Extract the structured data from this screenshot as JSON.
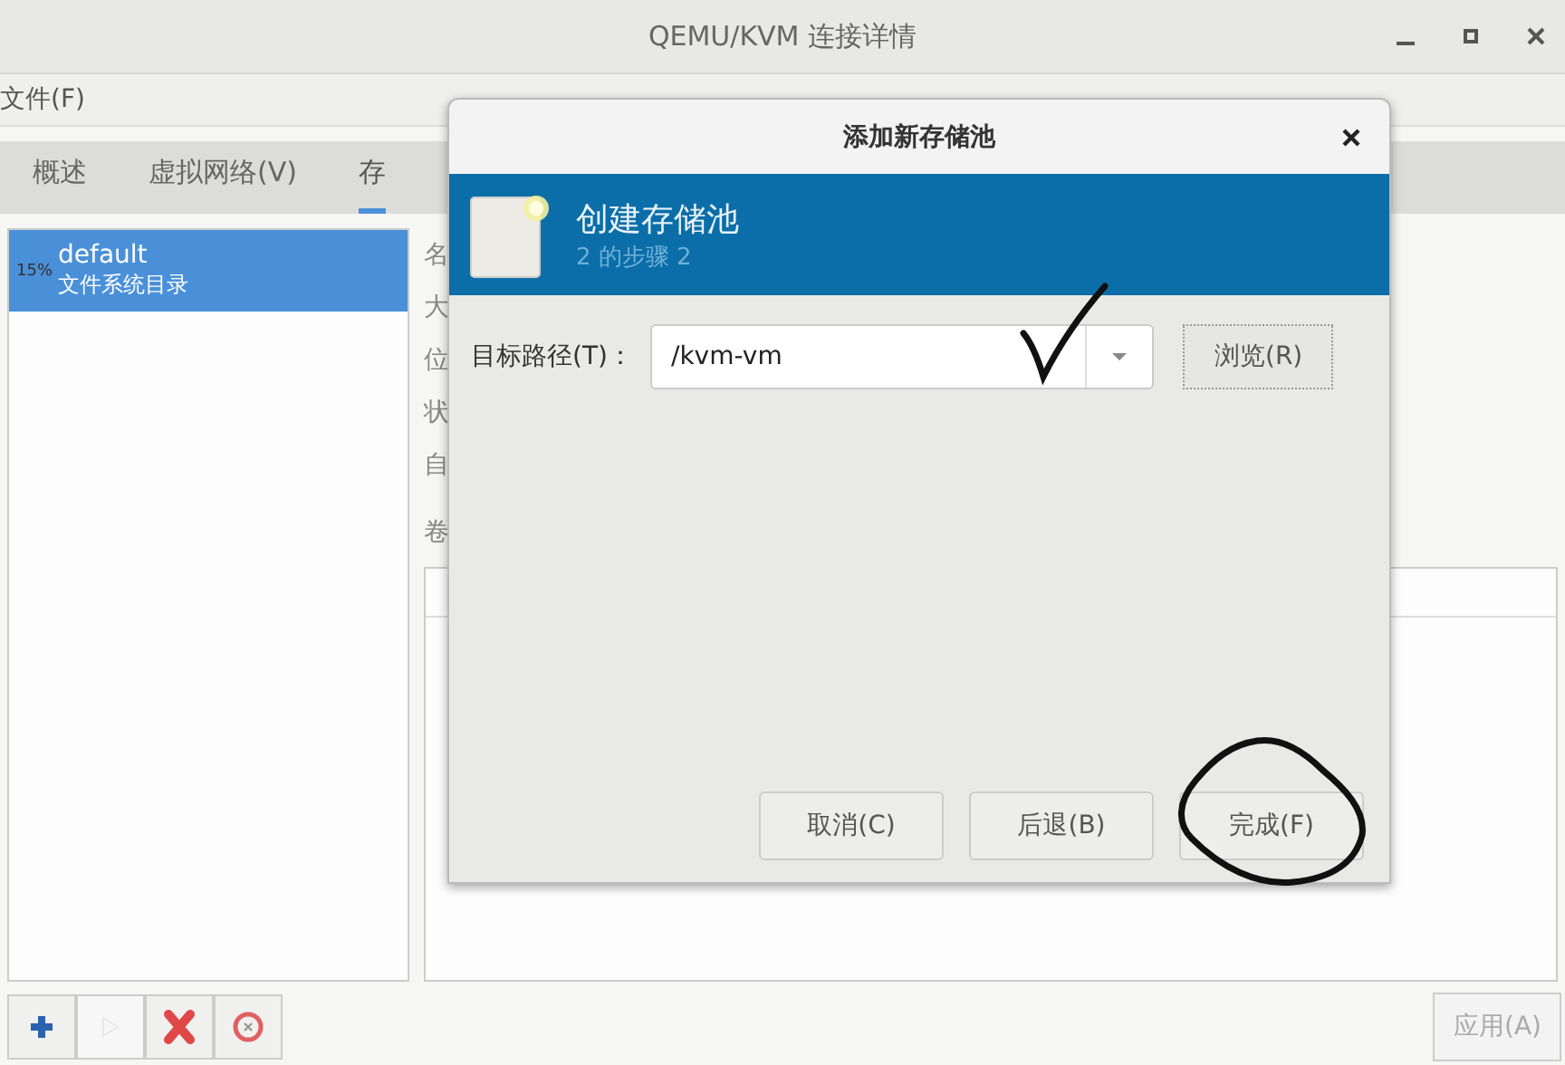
{
  "window": {
    "title": "QEMU/KVM 连接详情"
  },
  "menu": [
    "文件(F)"
  ],
  "tabs": [
    {
      "label": "概述",
      "selected": false
    },
    {
      "label": "虚拟网络(V)",
      "selected": false
    },
    {
      "label": "存",
      "selected": true
    }
  ],
  "pools": [
    {
      "usage": "15%",
      "name": "default",
      "type": "文件系统目录",
      "selected": true
    }
  ],
  "detail_labels": [
    "名",
    "大",
    "位",
    "状",
    "自"
  ],
  "volumes_label": "卷",
  "toolbar": [
    {
      "kind": "add",
      "disabled": false
    },
    {
      "kind": "start",
      "disabled": true
    },
    {
      "kind": "delete",
      "disabled": false
    },
    {
      "kind": "stop",
      "disabled": false
    }
  ],
  "apply_button": {
    "label": "应用(A)",
    "disabled": true
  },
  "dialog": {
    "title": "添加新存储池",
    "header_title": "创建存储池",
    "header_step": "2 的步骤 2",
    "field_label": "目标路径(T)：",
    "field_value": "/kvm-vm",
    "browse_button": "浏览(R)",
    "buttons": [
      "取消(C)",
      "后退(B)",
      "完成(F)"
    ]
  }
}
